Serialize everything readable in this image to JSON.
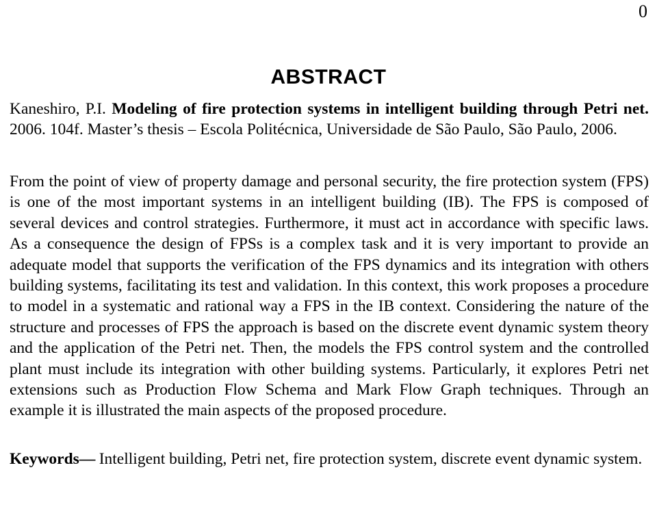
{
  "document": {
    "page_number": "0",
    "heading": "ABSTRACT",
    "citation": {
      "author": "Kaneshiro, P.I. ",
      "title": "Modeling of fire protection systems in intelligent building through Petri net.",
      "publication_info": " 2006. 104f. Master’s thesis – Escola Politécnica, Universidade de São Paulo, São Paulo, 2006."
    },
    "abstract_text": "From the point of view of property damage and personal security, the fire protection system (FPS) is one of the most important systems in an intelligent building (IB). The FPS is composed of several devices and control strategies. Furthermore, it must act in accordance with specific laws. As a consequence the design of FPSs is a complex task and it is very important to provide an adequate model that supports the verification of the FPS dynamics and its integration with others building systems, facilitating its test and validation. In this context, this work proposes a procedure to model in a systematic and rational way a FPS in the IB context. Considering the nature of the structure and processes of FPS the approach is based on the discrete event dynamic system theory and the application of the Petri net. Then, the models the FPS control system and the controlled plant must include its integration with other building systems. Particularly, it explores Petri net extensions such as Production Flow Schema and Mark Flow Graph techniques. Through an example it is illustrated the main aspects of the proposed procedure.",
    "keywords": {
      "label": "Keywords",
      "dash": "—",
      "list": " Intelligent building, Petri net, fire protection system, discrete event dynamic system."
    }
  }
}
